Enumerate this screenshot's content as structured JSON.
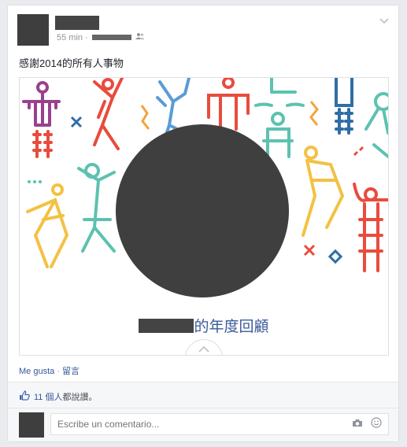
{
  "post": {
    "time": "55 min",
    "separator": "·",
    "body": "感謝2014的所有人事物"
  },
  "share": {
    "caption_suffix": "的年度回顧"
  },
  "actions": {
    "like": "Me gusta",
    "dot": "·",
    "comment": "留言"
  },
  "footer": {
    "like_count": "11 個人",
    "like_suffix": "都說讚。"
  },
  "comment": {
    "placeholder": "Escribe un comentario..."
  },
  "colors": {
    "link": "#365899",
    "accent_blue": "#3b5998",
    "bg": "#e9ebee"
  },
  "icons": [
    "chevron-down-icon",
    "friends-icon",
    "thumbs-up-icon",
    "camera-icon",
    "smile-icon"
  ]
}
